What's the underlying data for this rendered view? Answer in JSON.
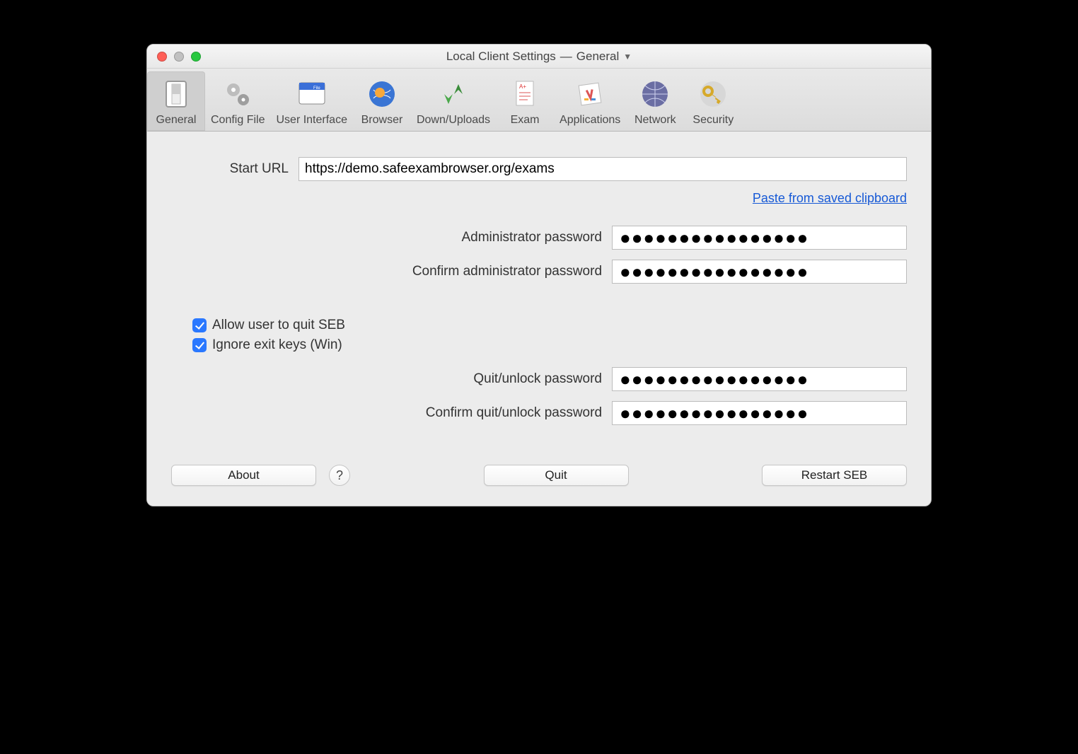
{
  "window": {
    "title_left": "Local Client Settings",
    "title_sep": "—",
    "title_right": "General"
  },
  "toolbar": {
    "items": [
      {
        "label": "General",
        "icon": "switch-icon",
        "selected": true
      },
      {
        "label": "Config File",
        "icon": "gears-icon",
        "selected": false
      },
      {
        "label": "User Interface",
        "icon": "window-icon",
        "selected": false
      },
      {
        "label": "Browser",
        "icon": "globe-icon",
        "selected": false
      },
      {
        "label": "Down/Uploads",
        "icon": "arrows-icon",
        "selected": false
      },
      {
        "label": "Exam",
        "icon": "paper-icon",
        "selected": false
      },
      {
        "label": "Applications",
        "icon": "apps-icon",
        "selected": false
      },
      {
        "label": "Network",
        "icon": "network-icon",
        "selected": false
      },
      {
        "label": "Security",
        "icon": "key-icon",
        "selected": false
      }
    ]
  },
  "form": {
    "start_url_label": "Start URL",
    "start_url_value": "https://demo.safeexambrowser.org/exams",
    "paste_link": "Paste from saved clipboard",
    "admin_pw_label": "Administrator password",
    "admin_pw_value": "●●●●●●●●●●●●●●●●",
    "admin_pw_confirm_label": "Confirm administrator password",
    "admin_pw_confirm_value": "●●●●●●●●●●●●●●●●",
    "allow_quit_label": "Allow user to quit SEB",
    "allow_quit_checked": true,
    "ignore_exit_label": "Ignore exit keys (Win)",
    "ignore_exit_checked": true,
    "quit_pw_label": "Quit/unlock password",
    "quit_pw_value": "●●●●●●●●●●●●●●●●",
    "quit_pw_confirm_label": "Confirm quit/unlock password",
    "quit_pw_confirm_value": "●●●●●●●●●●●●●●●●"
  },
  "buttons": {
    "about": "About",
    "help": "?",
    "quit": "Quit",
    "restart": "Restart SEB"
  }
}
